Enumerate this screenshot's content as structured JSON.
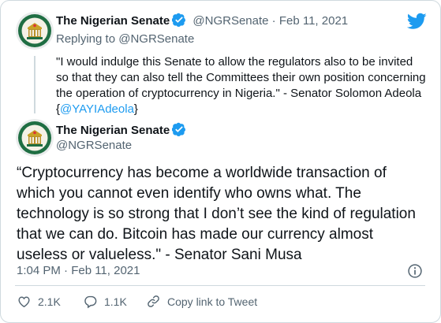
{
  "brand": {
    "accent_color": "#1d9bf0",
    "icon": "twitter-bird-icon"
  },
  "parent_tweet": {
    "author_name": "The Nigerian Senate",
    "handle": "@NGRSenate",
    "separator": "·",
    "date": "Feb 11, 2021",
    "replying_prefix": "Replying to",
    "replying_handle": "@NGRSenate",
    "text_body": "\"I would indulge this Senate to allow the regulators also to be invited so that they can also tell the Committees their own position concerning the operation of cryptocurrency in Nigeria.\" - Senator Solomon Adeola  {",
    "text_mention": "@YAYIAdeola",
    "text_end": "}"
  },
  "main_tweet": {
    "author_name": "The Nigerian Senate",
    "handle": "@NGRSenate",
    "text": "“Cryptocurrency has become a worldwide transaction of which you cannot even identify who owns what. The technology is so strong that I don’t see the kind of regulation that we can do. Bitcoin has made our currency almost useless or valueless.\" - Senator Sani Musa",
    "timestamp": "1:04 PM · Feb 11, 2021"
  },
  "actions": {
    "likes": "2.1K",
    "replies": "1.1K",
    "copy_link": "Copy link to Tweet"
  }
}
